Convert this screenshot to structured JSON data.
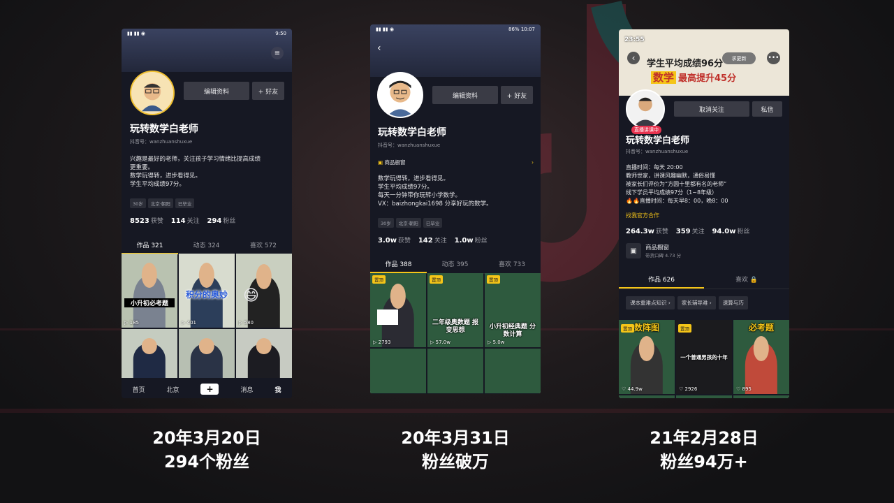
{
  "phone1": {
    "status_time": "9:50",
    "name": "玩转数学白老师",
    "douyin_id": "抖音号：wanzhuanshuxue",
    "edit_label": "编辑资料",
    "friend_label": "+ 好友",
    "bio": [
      "兴趣是最好的老师，关注孩子学习情绪比提高成绩",
      "更重要。",
      "数学玩得转，进步看得见。",
      "学生平均成绩97分。"
    ],
    "tags": [
      "30岁",
      "北京·朝阳",
      "已毕业"
    ],
    "likes": "8523",
    "likes_label": "获赞",
    "following": "114",
    "following_label": "关注",
    "fans": "294",
    "fans_label": "粉丝",
    "tabs": [
      "作品 321",
      "动态 324",
      "喜欢 572"
    ],
    "videos": [
      {
        "text": "小升初必考题",
        "plays": "185"
      },
      {
        "text": "积分的奥妙",
        "plays": "401"
      },
      {
        "text": "",
        "plays": "580"
      },
      {
        "text": "",
        "plays": ""
      },
      {
        "text": "",
        "plays": ""
      },
      {
        "text": "",
        "plays": ""
      }
    ],
    "nav": [
      "首页",
      "北京",
      "+",
      "消息",
      "我"
    ]
  },
  "phone2": {
    "status_time": "10:07",
    "battery": "86%",
    "name": "玩转数学白老师",
    "douyin_id": "抖音号：wanzhuanshuxue",
    "edit_label": "编辑资料",
    "friend_label": "+ 好友",
    "shop_label": "商品橱窗",
    "bio": [
      "数学玩得转，进步看得见。",
      "学生平均成绩97分。",
      "每天一分钟带你玩转小学数学。",
      "VX：baizhongkai1698 分享好玩的数学。"
    ],
    "tags": [
      "30岁",
      "北京·朝阳",
      "已毕业"
    ],
    "likes": "3.0w",
    "likes_label": "获赞",
    "following": "142",
    "following_label": "关注",
    "fans": "1.0w",
    "fans_label": "粉丝",
    "tabs": [
      "作品 388",
      "动态 395",
      "喜欢 733"
    ],
    "videos": [
      {
        "pin": "置顶",
        "text": "",
        "plays": "2793"
      },
      {
        "pin": "置顶",
        "text": "二年级奥数题 报变思想",
        "plays": "57.0w"
      },
      {
        "pin": "置顶",
        "text": "小升初经典题 分数计算",
        "plays": "5.0w"
      },
      {
        "pin": "",
        "text": "",
        "plays": ""
      },
      {
        "pin": "",
        "text": "",
        "plays": ""
      },
      {
        "pin": "",
        "text": "",
        "plays": ""
      }
    ]
  },
  "phone3": {
    "status_time": "23:55",
    "banner_line1": "学生平均成绩96分",
    "banner_line2a": "数学",
    "banner_line2b": "最高提升45分",
    "update_label": "求更新",
    "unfollow_label": "取消关注",
    "message_label": "私信",
    "live_badge": "直播讲课中",
    "name": "玩转数学白老师",
    "douyin_id": "抖音号：wanzhuanshuxue",
    "bio": [
      "直播时间：每天 20:00",
      "教师世家，讲课风趣幽默，通俗易懂",
      "被家长们评价为“方圆十里都有名的老师”",
      "线下学员平均成绩97分（1~8年级）",
      "🔥🔥直播时间：每天早8：00，晚8：00"
    ],
    "biz_link": "找我官方合作",
    "likes": "264.3w",
    "likes_label": "获赞",
    "following": "359",
    "following_label": "关注",
    "fans": "94.0w",
    "fans_label": "粉丝",
    "shop_label": "商品橱窗",
    "shop_sub": "带货口碑 4.73 分",
    "tabs": [
      "作品 626",
      "喜欢 🔒"
    ],
    "chips": [
      "课本重难点知识 ›",
      "家长辅导难 ›",
      "速算与巧"
    ],
    "videos": [
      {
        "pin": "置顶",
        "title": "数阵图",
        "plays": "44.9w"
      },
      {
        "pin": "置顶",
        "title": "一个普通男孩的十年",
        "plays": "2926"
      },
      {
        "pin": "",
        "title": "必考题",
        "plays": "895"
      }
    ]
  },
  "captions": [
    {
      "line1": "20年3月20日",
      "line2": "294个粉丝"
    },
    {
      "line1": "20年3月31日",
      "line2": "粉丝破万"
    },
    {
      "line1": "21年2月28日",
      "line2": "粉丝94万+"
    }
  ]
}
